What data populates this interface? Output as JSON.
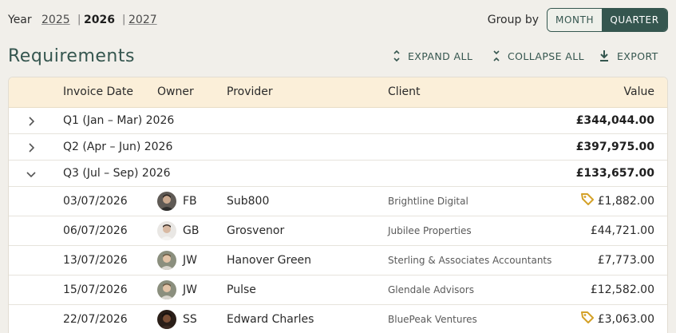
{
  "year_selector": {
    "label": "Year",
    "years": [
      {
        "label": "2025",
        "current": false
      },
      {
        "label": "2026",
        "current": true
      },
      {
        "label": "2027",
        "current": false
      }
    ],
    "separator": "|"
  },
  "group_by": {
    "label": "Group by",
    "options": [
      "MONTH",
      "QUARTER"
    ],
    "selected": "QUARTER"
  },
  "page": {
    "title": "Requirements",
    "actions": {
      "expand_all": "EXPAND ALL",
      "collapse_all": "COLLAPSE ALL",
      "export": "EXPORT"
    }
  },
  "table": {
    "columns": [
      "Invoice Date",
      "Owner",
      "Provider",
      "Client",
      "Value"
    ],
    "groups": [
      {
        "label": "Q1 (Jan – Mar) 2026",
        "total": "£344,044.00",
        "expanded": false
      },
      {
        "label": "Q2 (Apr – Jun) 2026",
        "total": "£397,975.00",
        "expanded": false
      },
      {
        "label": "Q3 (Jul – Sep) 2026",
        "total": "£133,657.00",
        "expanded": true
      }
    ],
    "rows": [
      {
        "date": "03/07/2026",
        "owner": "FB",
        "provider": "Sub800",
        "client": "Brightline Digital",
        "value": "£1,882.00",
        "tagged": true,
        "avatar": "avatar-fb"
      },
      {
        "date": "06/07/2026",
        "owner": "GB",
        "provider": "Grosvenor",
        "client": "Jubilee Properties",
        "value": "£44,721.00",
        "tagged": false,
        "avatar": "avatar-gb"
      },
      {
        "date": "13/07/2026",
        "owner": "JW",
        "provider": "Hanover Green",
        "client": "Sterling & Associates Accountants",
        "value": "£7,773.00",
        "tagged": false,
        "avatar": "avatar-jw"
      },
      {
        "date": "15/07/2026",
        "owner": "JW",
        "provider": "Pulse",
        "client": "Glendale Advisors",
        "value": "£12,582.00",
        "tagged": false,
        "avatar": "avatar-jw"
      },
      {
        "date": "22/07/2026",
        "owner": "SS",
        "provider": "Edward Charles",
        "client": "BluePeak Ventures",
        "value": "£3,063.00",
        "tagged": true,
        "avatar": "avatar-ss"
      }
    ]
  },
  "colors": {
    "accent": "#35564f",
    "header_bg": "#fbefd9",
    "page_bg": "#f1efea",
    "tag": "#d4a128"
  }
}
